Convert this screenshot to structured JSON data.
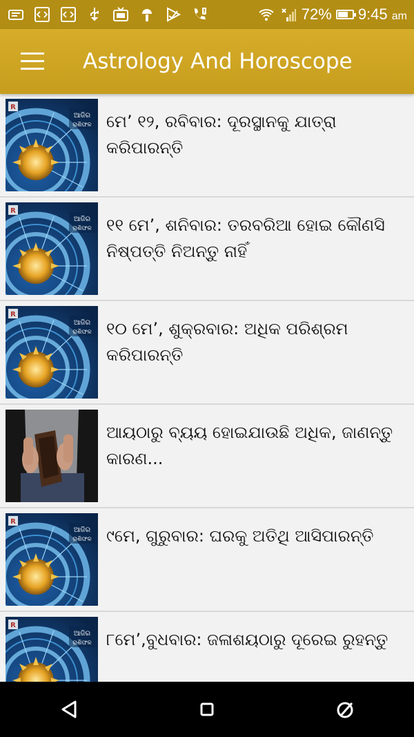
{
  "status_bar": {
    "battery": "72%",
    "time": "9:45",
    "ampm": "am",
    "battery_level": 0.72
  },
  "app_bar": {
    "title": "Astrology And Horoscope",
    "color": "#c79d1d"
  },
  "articles": [
    {
      "title": "ମେ’ ୧୨, ରବିବାର: ଦୂରସ୍ଥାନକୁ ଯାତ୍ରା କରିପାରନ୍ତି",
      "thumb_text": [
        "ଆଜିର",
        "ରାଶିଫଳ"
      ],
      "thumb_logo": "R",
      "thumbnail": "zodiac-wheel"
    },
    {
      "title": "୧୧ ମେ’, ଶନିବାର: ତରବରିଆ ହୋଇ କୌଣସି ନିଷ୍ପତ୍ତି ନିଅନ୍ତୁ ନାହିଁ",
      "thumb_text": [
        "ଆଜିର",
        "ରାଶିଫଳ"
      ],
      "thumb_logo": "R",
      "thumbnail": "zodiac-wheel"
    },
    {
      "title": "୧୦ ମେ’, ଶୁକ୍ରବାର: ଅଧିକ ପରିଶ୍ରମ କରିପାରନ୍ତି",
      "thumb_text": [
        "ଆଜିର",
        "ରାଶିଫଳ"
      ],
      "thumb_logo": "R",
      "thumbnail": "zodiac-wheel"
    },
    {
      "title": "ଆୟଠାରୁ ବ୍ୟୟ ହୋଇଯାଉଛି ଅଧିକ, ଜାଣନ୍ତୁ କାରଣ...",
      "thumb_text": [],
      "thumb_logo": "",
      "thumbnail": "empty-wallet"
    },
    {
      "title": "୯ମେ, ଗୁରୁବାର: ଘରକୁ ଅତିଥି ଆସିପାରନ୍ତି",
      "thumb_text": [
        "ଆଜିର",
        "ରାଶିଫଳ"
      ],
      "thumb_logo": "R",
      "thumbnail": "zodiac-wheel"
    },
    {
      "title": "୮ମେ’,ବୁଧବାର: ଜଳାଶୟଠାରୁ ଦୂରେଇ ରୁହନ୍ତୁ",
      "thumb_text": [
        "ଆଜିର",
        "ରାଶିଫଳ"
      ],
      "thumb_logo": "R",
      "thumbnail": "zodiac-wheel"
    }
  ],
  "nav_bar": {
    "back": "back-icon",
    "home": "home-icon",
    "recents": "recents-icon"
  }
}
